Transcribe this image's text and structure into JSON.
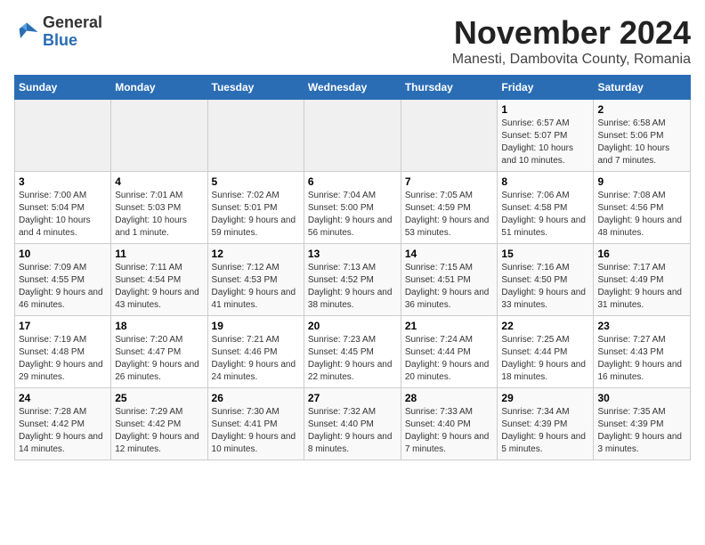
{
  "header": {
    "logo_general": "General",
    "logo_blue": "Blue",
    "month": "November 2024",
    "location": "Manesti, Dambovita County, Romania"
  },
  "weekdays": [
    "Sunday",
    "Monday",
    "Tuesday",
    "Wednesday",
    "Thursday",
    "Friday",
    "Saturday"
  ],
  "weeks": [
    [
      {
        "day": "",
        "info": ""
      },
      {
        "day": "",
        "info": ""
      },
      {
        "day": "",
        "info": ""
      },
      {
        "day": "",
        "info": ""
      },
      {
        "day": "",
        "info": ""
      },
      {
        "day": "1",
        "info": "Sunrise: 6:57 AM\nSunset: 5:07 PM\nDaylight: 10 hours and 10 minutes."
      },
      {
        "day": "2",
        "info": "Sunrise: 6:58 AM\nSunset: 5:06 PM\nDaylight: 10 hours and 7 minutes."
      }
    ],
    [
      {
        "day": "3",
        "info": "Sunrise: 7:00 AM\nSunset: 5:04 PM\nDaylight: 10 hours and 4 minutes."
      },
      {
        "day": "4",
        "info": "Sunrise: 7:01 AM\nSunset: 5:03 PM\nDaylight: 10 hours and 1 minute."
      },
      {
        "day": "5",
        "info": "Sunrise: 7:02 AM\nSunset: 5:01 PM\nDaylight: 9 hours and 59 minutes."
      },
      {
        "day": "6",
        "info": "Sunrise: 7:04 AM\nSunset: 5:00 PM\nDaylight: 9 hours and 56 minutes."
      },
      {
        "day": "7",
        "info": "Sunrise: 7:05 AM\nSunset: 4:59 PM\nDaylight: 9 hours and 53 minutes."
      },
      {
        "day": "8",
        "info": "Sunrise: 7:06 AM\nSunset: 4:58 PM\nDaylight: 9 hours and 51 minutes."
      },
      {
        "day": "9",
        "info": "Sunrise: 7:08 AM\nSunset: 4:56 PM\nDaylight: 9 hours and 48 minutes."
      }
    ],
    [
      {
        "day": "10",
        "info": "Sunrise: 7:09 AM\nSunset: 4:55 PM\nDaylight: 9 hours and 46 minutes."
      },
      {
        "day": "11",
        "info": "Sunrise: 7:11 AM\nSunset: 4:54 PM\nDaylight: 9 hours and 43 minutes."
      },
      {
        "day": "12",
        "info": "Sunrise: 7:12 AM\nSunset: 4:53 PM\nDaylight: 9 hours and 41 minutes."
      },
      {
        "day": "13",
        "info": "Sunrise: 7:13 AM\nSunset: 4:52 PM\nDaylight: 9 hours and 38 minutes."
      },
      {
        "day": "14",
        "info": "Sunrise: 7:15 AM\nSunset: 4:51 PM\nDaylight: 9 hours and 36 minutes."
      },
      {
        "day": "15",
        "info": "Sunrise: 7:16 AM\nSunset: 4:50 PM\nDaylight: 9 hours and 33 minutes."
      },
      {
        "day": "16",
        "info": "Sunrise: 7:17 AM\nSunset: 4:49 PM\nDaylight: 9 hours and 31 minutes."
      }
    ],
    [
      {
        "day": "17",
        "info": "Sunrise: 7:19 AM\nSunset: 4:48 PM\nDaylight: 9 hours and 29 minutes."
      },
      {
        "day": "18",
        "info": "Sunrise: 7:20 AM\nSunset: 4:47 PM\nDaylight: 9 hours and 26 minutes."
      },
      {
        "day": "19",
        "info": "Sunrise: 7:21 AM\nSunset: 4:46 PM\nDaylight: 9 hours and 24 minutes."
      },
      {
        "day": "20",
        "info": "Sunrise: 7:23 AM\nSunset: 4:45 PM\nDaylight: 9 hours and 22 minutes."
      },
      {
        "day": "21",
        "info": "Sunrise: 7:24 AM\nSunset: 4:44 PM\nDaylight: 9 hours and 20 minutes."
      },
      {
        "day": "22",
        "info": "Sunrise: 7:25 AM\nSunset: 4:44 PM\nDaylight: 9 hours and 18 minutes."
      },
      {
        "day": "23",
        "info": "Sunrise: 7:27 AM\nSunset: 4:43 PM\nDaylight: 9 hours and 16 minutes."
      }
    ],
    [
      {
        "day": "24",
        "info": "Sunrise: 7:28 AM\nSunset: 4:42 PM\nDaylight: 9 hours and 14 minutes."
      },
      {
        "day": "25",
        "info": "Sunrise: 7:29 AM\nSunset: 4:42 PM\nDaylight: 9 hours and 12 minutes."
      },
      {
        "day": "26",
        "info": "Sunrise: 7:30 AM\nSunset: 4:41 PM\nDaylight: 9 hours and 10 minutes."
      },
      {
        "day": "27",
        "info": "Sunrise: 7:32 AM\nSunset: 4:40 PM\nDaylight: 9 hours and 8 minutes."
      },
      {
        "day": "28",
        "info": "Sunrise: 7:33 AM\nSunset: 4:40 PM\nDaylight: 9 hours and 7 minutes."
      },
      {
        "day": "29",
        "info": "Sunrise: 7:34 AM\nSunset: 4:39 PM\nDaylight: 9 hours and 5 minutes."
      },
      {
        "day": "30",
        "info": "Sunrise: 7:35 AM\nSunset: 4:39 PM\nDaylight: 9 hours and 3 minutes."
      }
    ]
  ]
}
